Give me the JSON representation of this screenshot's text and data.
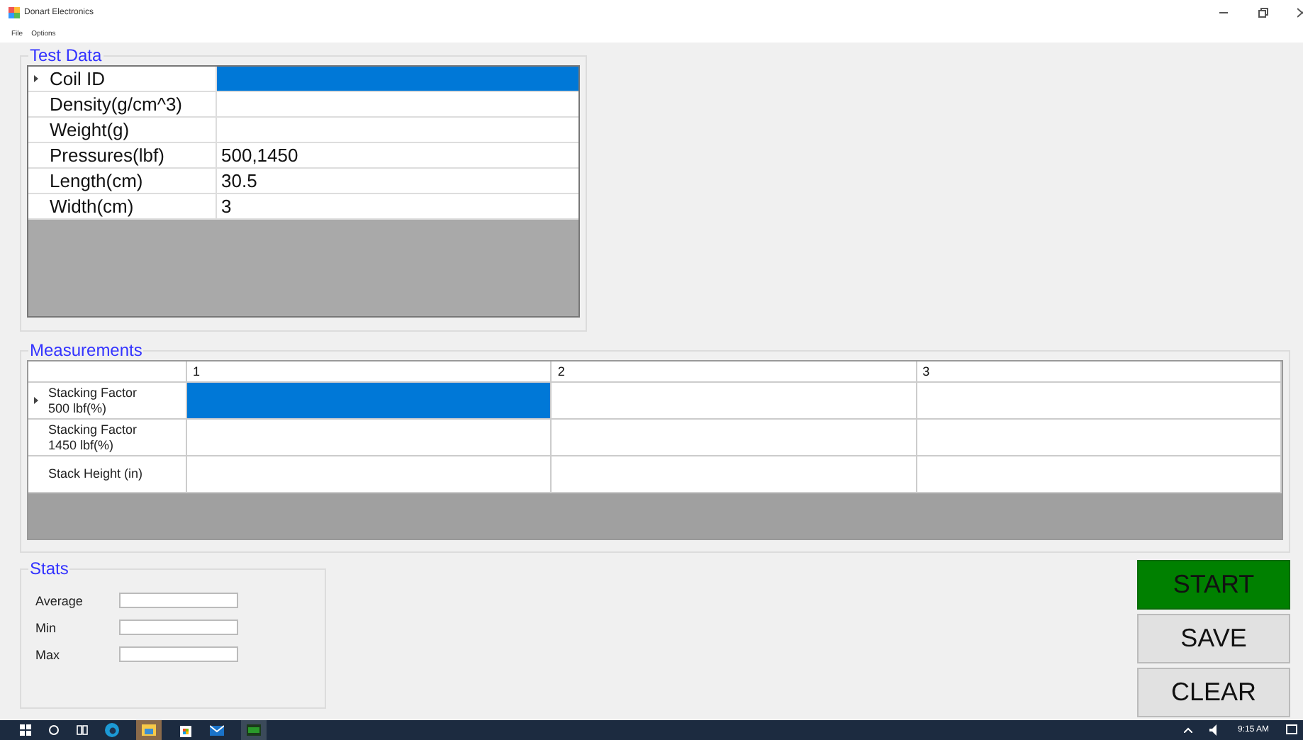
{
  "window": {
    "title": "Donart Electronics"
  },
  "menu": [
    "File",
    "Options"
  ],
  "test_data": {
    "title": "Test Data",
    "rows": [
      {
        "label": "Coil ID",
        "selected": true
      },
      {
        "label": "Density(g/cm^3)",
        "selected": false
      },
      {
        "label": "Weight(g)",
        "selected": false
      },
      {
        "label": "Pressures(lbf)",
        "value": "500,1450",
        "selected": false
      },
      {
        "label": "Length(cm)",
        "value": "30.5",
        "selected": false
      },
      {
        "label": "Width(cm)",
        "value": "3",
        "selected": false
      }
    ]
  },
  "measurements": {
    "title": "Measurements",
    "columns": [
      "1",
      "2",
      "3"
    ],
    "rows": [
      {
        "label": "Stacking Factor\n500 lbf(%)",
        "cells": [
          {
            "selected": true
          },
          {
            "selected": false
          },
          {
            "selected": false
          }
        ]
      },
      {
        "label": "Stacking Factor\n1450 lbf(%)",
        "cells": [
          {
            "selected": false
          },
          {
            "selected": false
          },
          {
            "selected": false
          }
        ]
      },
      {
        "label": "Stack Height (in)",
        "cells": [
          {
            "selected": false
          },
          {
            "selected": false
          },
          {
            "selected": false
          }
        ]
      }
    ]
  },
  "stats": {
    "title": "Stats",
    "fields": [
      {
        "label": "Average"
      },
      {
        "label": "Min"
      },
      {
        "label": "Max"
      }
    ]
  },
  "buttons": [
    {
      "label": "START",
      "kind": "primary"
    },
    {
      "label": "SAVE",
      "kind": "normal"
    },
    {
      "label": "CLEAR",
      "kind": "normal"
    }
  ],
  "taskbar": {
    "clock": "9:15 AM"
  }
}
